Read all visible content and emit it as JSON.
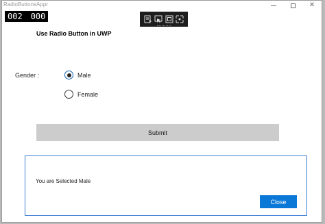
{
  "window": {
    "title": "RadioButtonsAppr",
    "controls": {
      "minimize_icon": "minimize-icon",
      "maximize_icon": "maximize-icon",
      "close_icon": "close-icon"
    }
  },
  "frame_counter": {
    "left": "002",
    "right": "000"
  },
  "debug_toolbar": {
    "icons": [
      "live-visual-tree-icon",
      "select-element-icon",
      "layout-adorners-icon",
      "track-focus-icon"
    ]
  },
  "main": {
    "heading": "Use Radio Button in UWP",
    "gender_label": "Gender :",
    "options": [
      {
        "label": "Male",
        "checked": true
      },
      {
        "label": "Female",
        "checked": false
      }
    ],
    "submit_label": "Submit"
  },
  "dialog": {
    "message": "You are Selected Male",
    "close_label": "Close"
  },
  "colors": {
    "accent": "#0a78d7",
    "submit_bg": "#cccccc",
    "dialog_border": "#3a7bd5",
    "toolbar_bg": "#1e1e1e"
  }
}
